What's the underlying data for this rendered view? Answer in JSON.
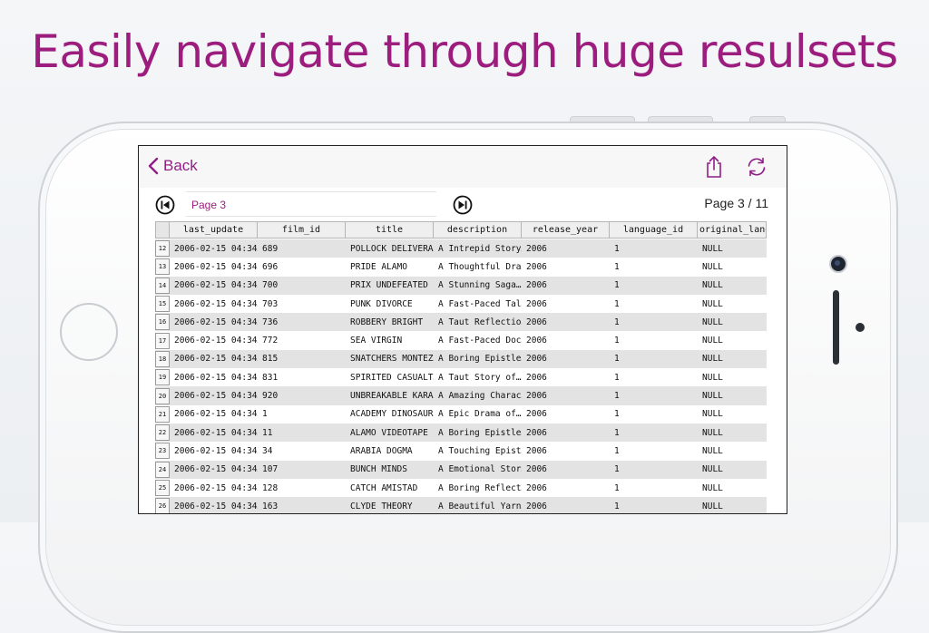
{
  "headline": "Easily navigate through huge resulsets",
  "navbar": {
    "back_label": "Back",
    "share_icon": "share-icon",
    "refresh_icon": "refresh-icon",
    "accent": "#8f1f86"
  },
  "pager": {
    "first_icon": "skip-to-first-icon",
    "next_icon": "skip-to-next-icon",
    "input_value": "Page 3",
    "page_count": "Page 3 / 11"
  },
  "table": {
    "columns": [
      "last_update",
      "film_id",
      "title",
      "description",
      "release_year",
      "language_id",
      "original_lang"
    ],
    "rows": [
      {
        "n": "12",
        "c": [
          "2006-02-15 04:34…",
          "689",
          "POLLOCK DELIVERA…",
          "A Intrepid Story…",
          "2006",
          "1",
          "NULL"
        ]
      },
      {
        "n": "13",
        "c": [
          "2006-02-15 04:34…",
          "696",
          "PRIDE ALAMO",
          "A Thoughtful Dra…",
          "2006",
          "1",
          "NULL"
        ]
      },
      {
        "n": "14",
        "c": [
          "2006-02-15 04:34…",
          "700",
          "PRIX UNDEFEATED",
          "A Stunning Saga…",
          "2006",
          "1",
          "NULL"
        ]
      },
      {
        "n": "15",
        "c": [
          "2006-02-15 04:34…",
          "703",
          "PUNK DIVORCE",
          "A Fast-Paced Tal…",
          "2006",
          "1",
          "NULL"
        ]
      },
      {
        "n": "16",
        "c": [
          "2006-02-15 04:34…",
          "736",
          "ROBBERY BRIGHT",
          "A Taut Reflectio…",
          "2006",
          "1",
          "NULL"
        ]
      },
      {
        "n": "17",
        "c": [
          "2006-02-15 04:34…",
          "772",
          "SEA VIRGIN",
          "A Fast-Paced Doc…",
          "2006",
          "1",
          "NULL"
        ]
      },
      {
        "n": "18",
        "c": [
          "2006-02-15 04:34…",
          "815",
          "SNATCHERS MONTEZ…",
          "A Boring Epistle…",
          "2006",
          "1",
          "NULL"
        ]
      },
      {
        "n": "19",
        "c": [
          "2006-02-15 04:34…",
          "831",
          "SPIRITED CASUALT…",
          "A Taut Story of…",
          "2006",
          "1",
          "NULL"
        ]
      },
      {
        "n": "20",
        "c": [
          "2006-02-15 04:34…",
          "920",
          "UNBREAKABLE KARA…",
          "A Amazing Charac…",
          "2006",
          "1",
          "NULL"
        ]
      },
      {
        "n": "21",
        "c": [
          "2006-02-15 04:34…",
          "1",
          "ACADEMY DINOSAUR",
          "A Epic Drama of…",
          "2006",
          "1",
          "NULL"
        ]
      },
      {
        "n": "22",
        "c": [
          "2006-02-15 04:34…",
          "11",
          "ALAMO VIDEOTAPE",
          "A Boring Epistle…",
          "2006",
          "1",
          "NULL"
        ]
      },
      {
        "n": "23",
        "c": [
          "2006-02-15 04:34…",
          "34",
          "ARABIA DOGMA",
          "A Touching Epist…",
          "2006",
          "1",
          "NULL"
        ]
      },
      {
        "n": "24",
        "c": [
          "2006-02-15 04:34…",
          "107",
          "BUNCH MINDS",
          "A Emotional Stor…",
          "2006",
          "1",
          "NULL"
        ]
      },
      {
        "n": "25",
        "c": [
          "2006-02-15 04:34…",
          "128",
          "CATCH AMISTAD",
          "A Boring Reflect…",
          "2006",
          "1",
          "NULL"
        ]
      },
      {
        "n": "26",
        "c": [
          "2006-02-15 04:34…",
          "163",
          "CLYDE THEORY",
          "A Beautiful Yarn…",
          "2006",
          "1",
          "NULL"
        ]
      }
    ]
  }
}
